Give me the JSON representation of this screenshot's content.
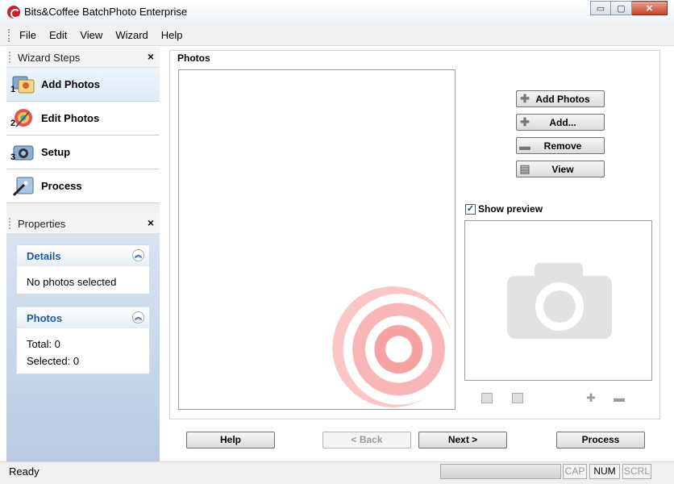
{
  "window": {
    "title": "Bits&Coffee BatchPhoto Enterprise",
    "minimize": "▭",
    "maximize": "▢",
    "close": "✕"
  },
  "menu": [
    "File",
    "Edit",
    "View",
    "Wizard",
    "Help"
  ],
  "wizard_steps": {
    "title": "Wizard Steps",
    "close": "×",
    "steps": [
      {
        "num": "1",
        "label": "Add Photos",
        "icon": "add-photos-icon"
      },
      {
        "num": "2",
        "label": "Edit Photos",
        "icon": "edit-photos-icon"
      },
      {
        "num": "3",
        "label": "Setup",
        "icon": "setup-icon"
      },
      {
        "num": "",
        "label": "Process",
        "icon": "process-icon"
      }
    ]
  },
  "properties": {
    "title": "Properties",
    "close": "×",
    "details": {
      "title": "Details",
      "text": "No photos selected"
    },
    "photos": {
      "title": "Photos",
      "total": "Total: 0",
      "selected": "Selected: 0"
    }
  },
  "photos_panel": {
    "label": "Photos",
    "buttons": {
      "add_photos": "Add Photos",
      "add": "Add...",
      "remove": "Remove",
      "view": "View"
    },
    "show_preview": "Show preview"
  },
  "nav": {
    "help": "Help",
    "back": "< Back",
    "next": "Next >",
    "process": "Process"
  },
  "status": {
    "text": "Ready",
    "cap": "CAP",
    "num": "NUM",
    "scrl": "SCRL"
  }
}
